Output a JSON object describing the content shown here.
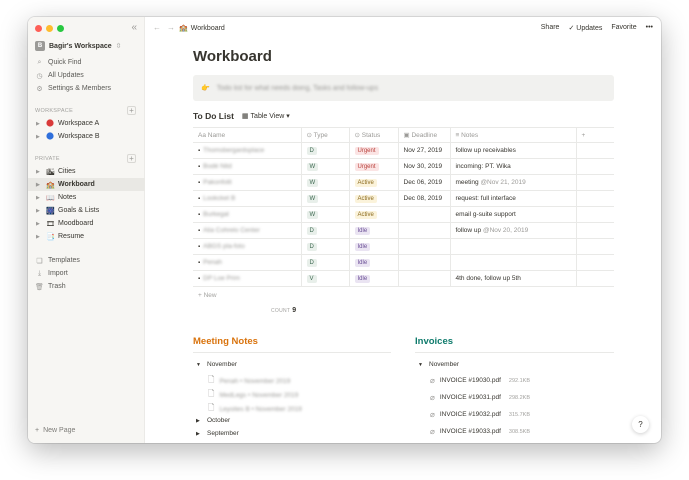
{
  "sidebar": {
    "workspace_initial": "B",
    "workspace_name": "Bagir's Workspace",
    "workspace_chevron": "⇳",
    "collapse_icon": "«",
    "nav": [
      {
        "label": "Quick Find",
        "icon": "search-icon"
      },
      {
        "label": "All Updates",
        "icon": "clock-icon"
      },
      {
        "label": "Settings & Members",
        "icon": "gear-icon"
      }
    ],
    "workspace_section": "WORKSPACE",
    "workspace_pages": [
      {
        "label": "Workspace A",
        "color": "#d93a3a"
      },
      {
        "label": "Workspace B",
        "color": "#2f6fdb"
      }
    ],
    "private_section": "PRIVATE",
    "private_pages": [
      {
        "label": "Cities",
        "emoji": "🏙"
      },
      {
        "label": "Workboard",
        "emoji": "🏫"
      },
      {
        "label": "Notes",
        "emoji": "📖"
      },
      {
        "label": "Goals & Lists",
        "emoji": "🎆"
      },
      {
        "label": "Moodboard",
        "emoji": "🎞"
      },
      {
        "label": "Resume",
        "emoji": "📑"
      }
    ],
    "tools": [
      {
        "label": "Templates",
        "icon": "template-icon"
      },
      {
        "label": "Import",
        "icon": "import-icon"
      },
      {
        "label": "Trash",
        "icon": "trash-icon"
      }
    ],
    "new_page": "New Page"
  },
  "topbar": {
    "breadcrumb": "Workboard",
    "share": "Share",
    "updates": "Updates",
    "favorite": "Favorite",
    "more": "•••"
  },
  "page": {
    "title": "Workboard",
    "callout_emoji": "👉",
    "callout_text": "Todo list for what needs doing, Tasks and follow-ups"
  },
  "database": {
    "title": "To Do List",
    "view": "Table View",
    "columns": [
      "Name",
      "Type",
      "Status",
      "Deadline",
      "Notes"
    ],
    "rows": [
      {
        "name": "Thomsbergardsplace",
        "type": "D",
        "status": "Urgent",
        "deadline": "Nov 27, 2019",
        "notes": "follow up receivables",
        "mention": ""
      },
      {
        "name": "Bodé Nitd",
        "type": "W",
        "status": "Urgent",
        "deadline": "Nov 30, 2019",
        "notes": "incoming: PT. Wika",
        "mention": ""
      },
      {
        "name": "Pakonfolit",
        "type": "W",
        "status": "Active",
        "deadline": "Dec 06, 2019",
        "notes": "meeting ",
        "mention": "@Nov 21, 2019"
      },
      {
        "name": "Lookcket B",
        "type": "W",
        "status": "Active",
        "deadline": "Dec 08, 2019",
        "notes": "request: full interface",
        "mention": ""
      },
      {
        "name": "Burkegal",
        "type": "W",
        "status": "Active",
        "deadline": "",
        "notes": "email g-suite support",
        "mention": ""
      },
      {
        "name": "Alia Cohrelo Center",
        "type": "D",
        "status": "Idle",
        "deadline": "",
        "notes": "follow up ",
        "mention": "@Nov 20, 2019"
      },
      {
        "name": "ABGS pla-foto",
        "type": "D",
        "status": "Idle",
        "deadline": "",
        "notes": "",
        "mention": ""
      },
      {
        "name": "Penah",
        "type": "D",
        "status": "Idle",
        "deadline": "",
        "notes": "",
        "mention": ""
      },
      {
        "name": "DP Loe Prim",
        "type": "V",
        "status": "Idle",
        "deadline": "",
        "notes": "4th done, follow up 5th",
        "mention": ""
      }
    ],
    "new_label": "New",
    "count_label": "COUNT",
    "count_value": "9",
    "colors": {
      "Urgent": {
        "bg": "#fbe4e4",
        "fg": "#b8403b"
      },
      "Active": {
        "bg": "#fbf3db",
        "fg": "#8b6a1c"
      },
      "Idle": {
        "bg": "#eae4f2",
        "fg": "#6b4f96"
      },
      "type": {
        "bg": "#e8efea",
        "fg": "#3f6a52"
      }
    }
  },
  "meeting_notes": {
    "title": "Meeting Notes",
    "title_color": "#d9730d",
    "groups": [
      {
        "label": "November",
        "open": true,
        "items": [
          "Penah • November 2019",
          "MedLegs • November 2019",
          "Leyoites B • November 2019"
        ]
      },
      {
        "label": "October",
        "open": false,
        "items": []
      },
      {
        "label": "September",
        "open": false,
        "items": []
      }
    ]
  },
  "invoices": {
    "title": "Invoices",
    "title_color": "#0f7b6c",
    "group": "November",
    "items": [
      {
        "name": "INVOICE #19030.pdf",
        "size": "292.1KB"
      },
      {
        "name": "INVOICE #19031.pdf",
        "size": "298.2KB"
      },
      {
        "name": "INVOICE #19032.pdf",
        "size": "315.7KB"
      },
      {
        "name": "INVOICE #19033.pdf",
        "size": "308.5KB"
      }
    ]
  },
  "help": "?"
}
